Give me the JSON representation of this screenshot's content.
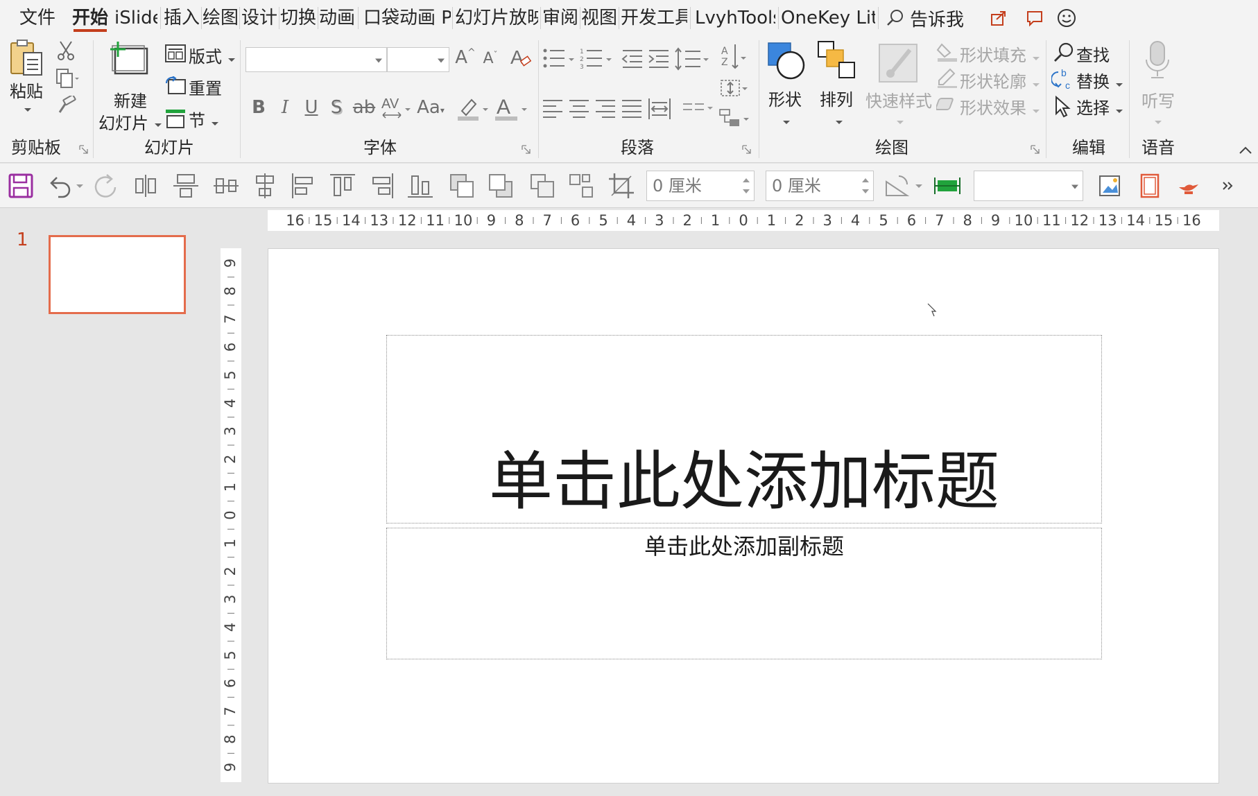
{
  "tabs": [
    "文件",
    "开始",
    "iSlide",
    "插入",
    "绘图",
    "设计",
    "切换",
    "动画",
    "口袋动画 PA",
    "幻灯片放映",
    "审阅",
    "视图",
    "开发工具",
    "LvyhTools",
    "OneKey Lite"
  ],
  "active_tab": "开始",
  "tell_me": "告诉我",
  "ribbon": {
    "clipboard": {
      "label": "剪贴板",
      "paste": "粘贴"
    },
    "slides": {
      "label": "幻灯片",
      "new_slide_line1": "新建",
      "new_slide_line2": "幻灯片",
      "layout": "版式",
      "reset": "重置",
      "section": "节"
    },
    "font": {
      "label": "字体",
      "font_name": "",
      "font_size": ""
    },
    "paragraph": {
      "label": "段落"
    },
    "drawing": {
      "label": "绘图",
      "shapes": "形状",
      "arrange": "排列",
      "quick_styles": "快速样式",
      "shape_fill": "形状填充",
      "shape_outline": "形状轮廓",
      "shape_effects": "形状效果"
    },
    "editing": {
      "label": "编辑",
      "find": "查找",
      "replace": "替换",
      "select": "选择"
    },
    "voice": {
      "label": "语音",
      "dictate": "听写"
    }
  },
  "quick_toolbar": {
    "spin1": "0 厘米",
    "spin2": "0 厘米",
    "combo": ""
  },
  "thumbnail": {
    "number": "1"
  },
  "ruler_h_labels": [
    "16",
    "15",
    "14",
    "13",
    "12",
    "11",
    "10",
    "9",
    "8",
    "7",
    "6",
    "5",
    "4",
    "3",
    "2",
    "1",
    "0",
    "1",
    "2",
    "3",
    "4",
    "5",
    "6",
    "7",
    "8",
    "9",
    "10",
    "11",
    "12",
    "13",
    "14",
    "15",
    "16"
  ],
  "ruler_v_labels": [
    "9",
    "8",
    "7",
    "6",
    "5",
    "4",
    "3",
    "2",
    "1",
    "0",
    "1",
    "2",
    "3",
    "4",
    "5",
    "6",
    "7",
    "8",
    "9"
  ],
  "slide": {
    "title_placeholder": "单击此处添加标题",
    "subtitle_placeholder": "单击此处添加副标题"
  },
  "colors": {
    "accent": "#c43e1c",
    "thumb_border": "#e46c4c",
    "ribbon_bg": "#f3f3f3",
    "workspace_bg": "#e6e6e6"
  }
}
